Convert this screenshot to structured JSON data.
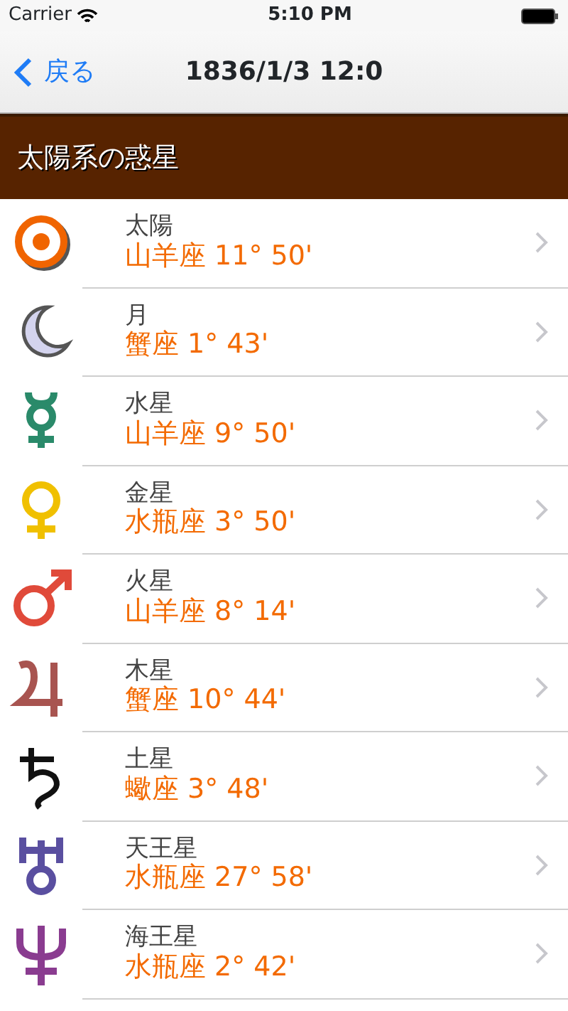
{
  "status_bar": {
    "carrier": "Carrier",
    "time": "5:10 PM"
  },
  "nav_bar": {
    "back": "戻る",
    "title": "1836/1/3 12:0"
  },
  "section": {
    "title": "太陽系の惑星"
  },
  "rows": [
    {
      "name": "太陽",
      "position": "山羊座 11° 50'"
    },
    {
      "name": "月",
      "position": "蟹座 1° 43'"
    },
    {
      "name": "水星",
      "position": "山羊座 9° 50'"
    },
    {
      "name": "金星",
      "position": "水瓶座 3° 50'"
    },
    {
      "name": "火星",
      "position": "山羊座 8° 14'"
    },
    {
      "name": "木星",
      "position": "蟹座 10° 44'"
    },
    {
      "name": "土星",
      "position": "蠍座 3° 48'"
    },
    {
      "name": "天王星",
      "position": "水瓶座 27° 58'"
    },
    {
      "name": "海王星",
      "position": "水瓶座 2° 42'"
    }
  ]
}
